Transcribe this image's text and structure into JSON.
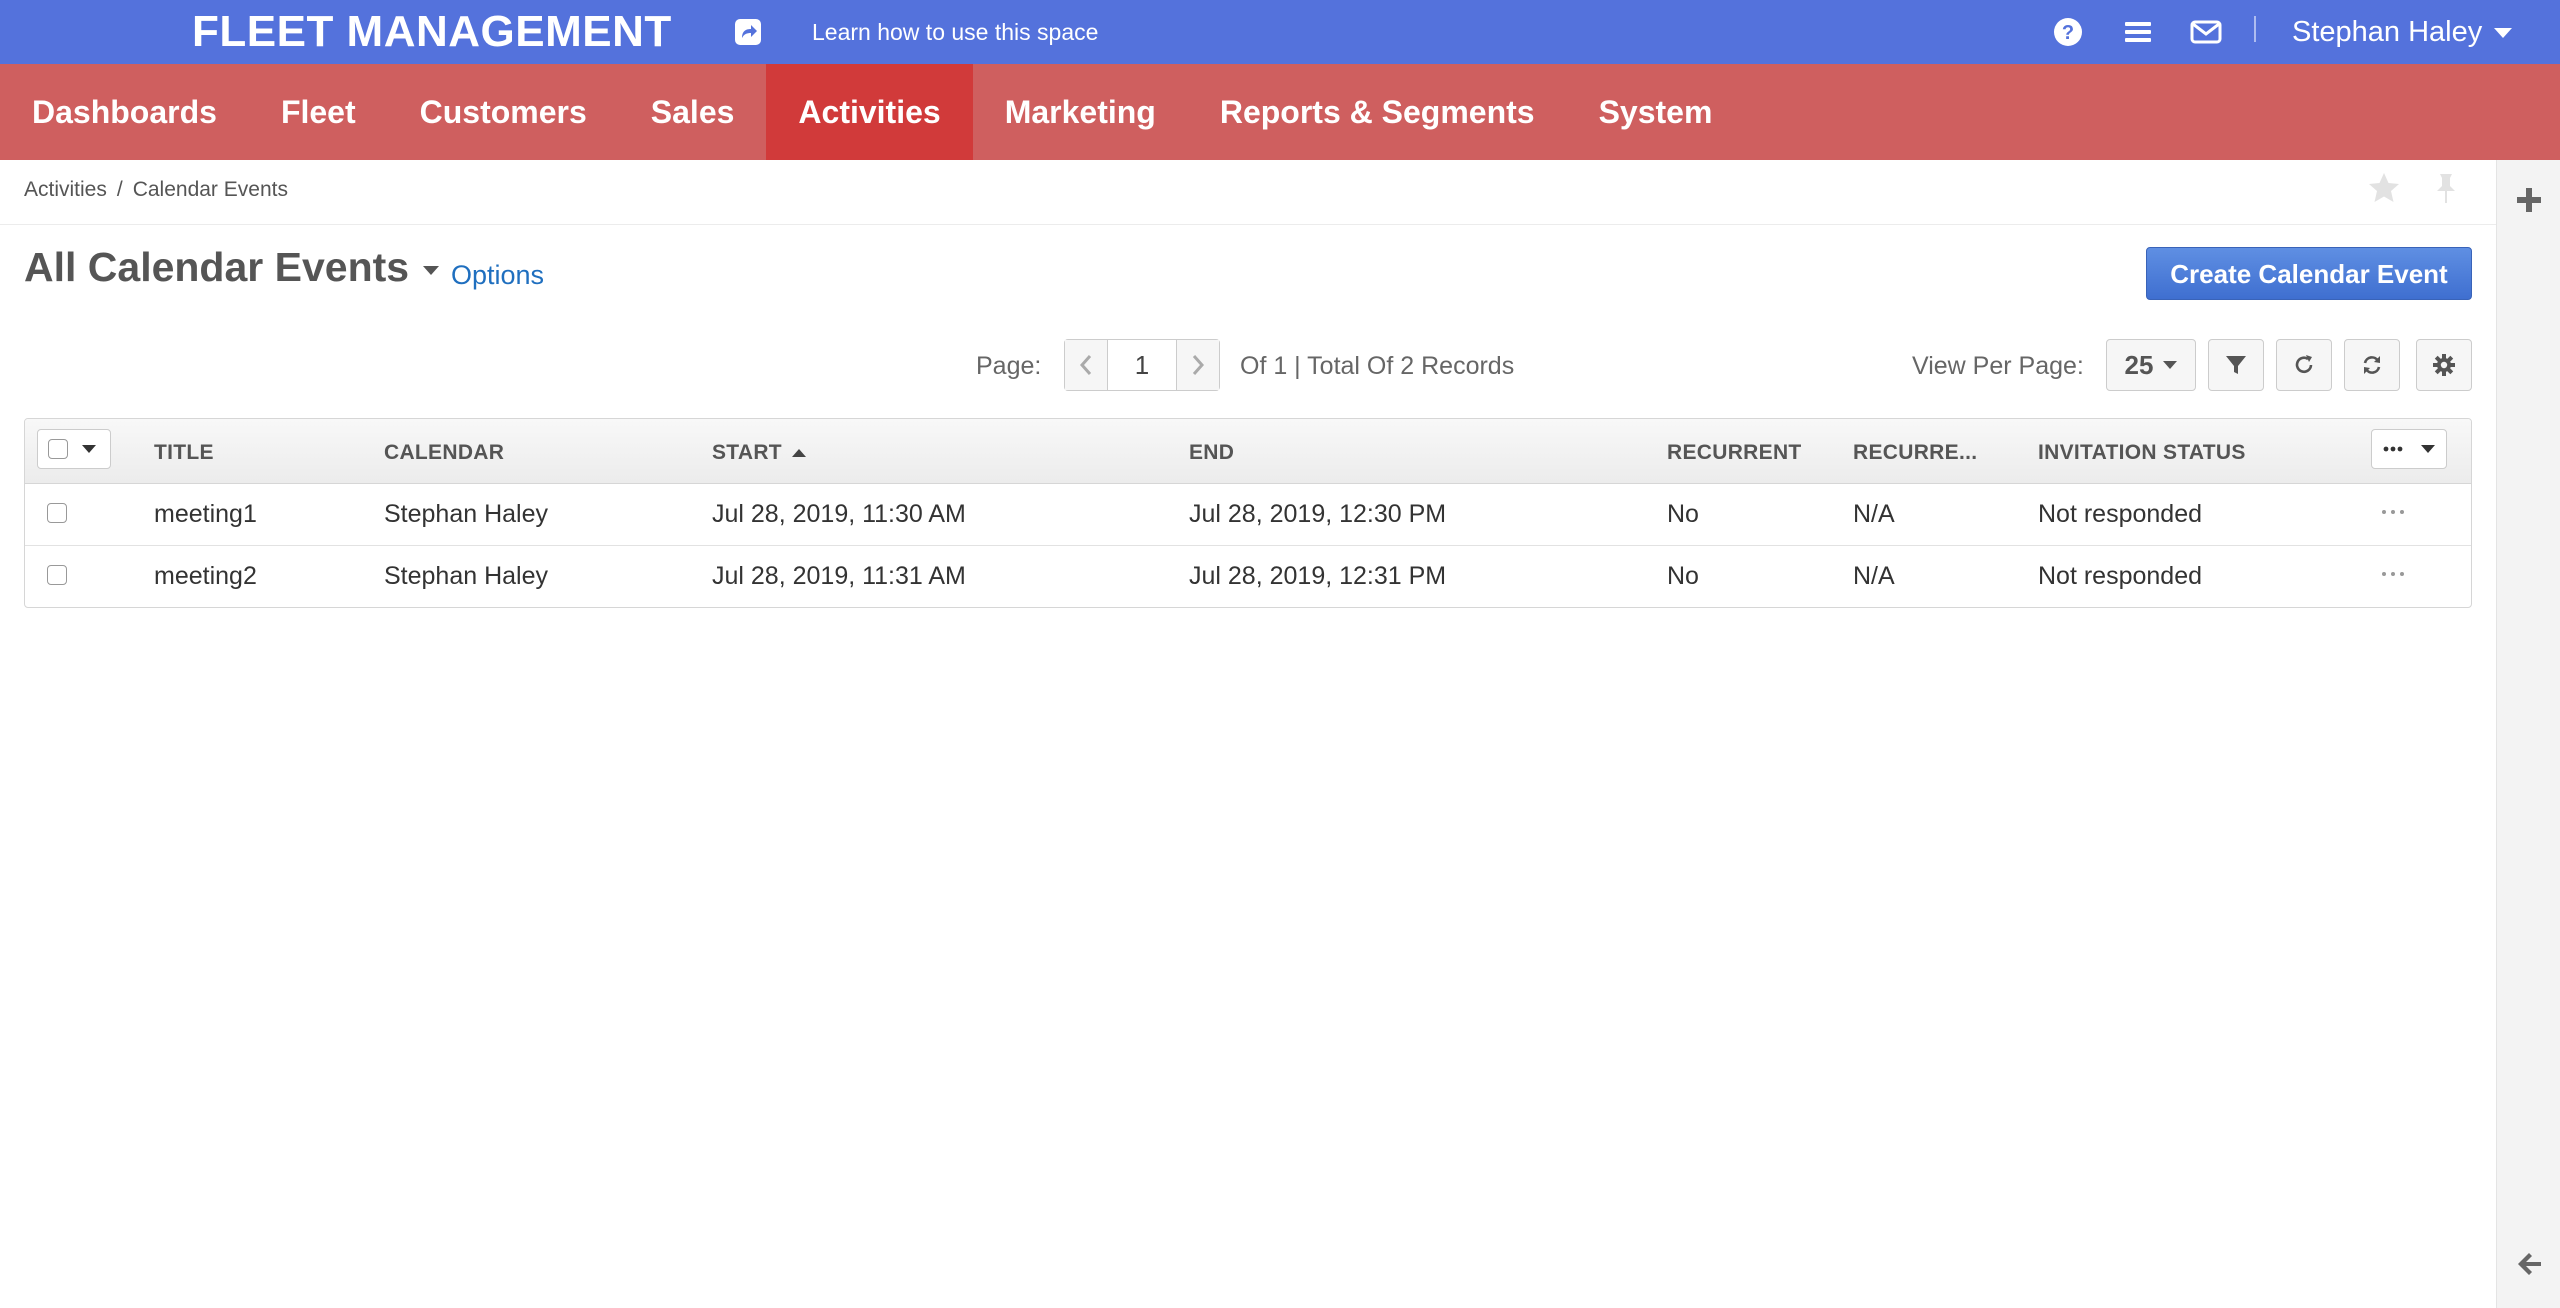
{
  "header": {
    "app_title": "FLEET MANAGEMENT",
    "learn_link": "Learn how to use this space",
    "user_name": "Stephan Haley"
  },
  "nav": {
    "items": [
      {
        "label": "Dashboards",
        "active": false
      },
      {
        "label": "Fleet",
        "active": false
      },
      {
        "label": "Customers",
        "active": false
      },
      {
        "label": "Sales",
        "active": false
      },
      {
        "label": "Activities",
        "active": true
      },
      {
        "label": "Marketing",
        "active": false
      },
      {
        "label": "Reports & Segments",
        "active": false
      },
      {
        "label": "System",
        "active": false
      }
    ]
  },
  "breadcrumb": {
    "parent": "Activities",
    "separator": "/",
    "current": "Calendar Events"
  },
  "page": {
    "title": "All Calendar Events",
    "options_label": "Options",
    "create_button": "Create Calendar Event"
  },
  "pager": {
    "page_label": "Page:",
    "current_page": "1",
    "summary": "Of 1 | Total Of 2 Records",
    "per_page_label": "View Per Page:",
    "per_page_value": "25"
  },
  "grid": {
    "columns": [
      "TITLE",
      "CALENDAR",
      "START",
      "END",
      "RECURRENT",
      "RECURRE...",
      "INVITATION STATUS"
    ],
    "sorted_column": "START",
    "rows": [
      {
        "title": "meeting1",
        "calendar": "Stephan Haley",
        "start": "Jul 28, 2019, 11:30 AM",
        "end": "Jul 28, 2019, 12:30 PM",
        "recurrent": "No",
        "recurrence": "N/A",
        "invitation_status": "Not responded"
      },
      {
        "title": "meeting2",
        "calendar": "Stephan Haley",
        "start": "Jul 28, 2019, 11:31 AM",
        "end": "Jul 28, 2019, 12:31 PM",
        "recurrent": "No",
        "recurrence": "N/A",
        "invitation_status": "Not responded"
      }
    ]
  },
  "colors": {
    "header_bg": "#5472dc",
    "nav_bg": "#cf5f5f",
    "nav_active_bg": "#d13a3a",
    "primary_button": "#4a7bd9",
    "link": "#1f6fbf"
  },
  "icons": {
    "share": "share-icon",
    "help": "help-icon",
    "menu": "menu-icon",
    "mail": "mail-icon",
    "star": "star-icon",
    "pin": "pin-icon",
    "filter": "filter-icon",
    "refresh": "refresh-icon",
    "reset": "reset-icon",
    "settings": "gear-icon",
    "add": "plus-icon",
    "back": "arrow-left-icon"
  }
}
